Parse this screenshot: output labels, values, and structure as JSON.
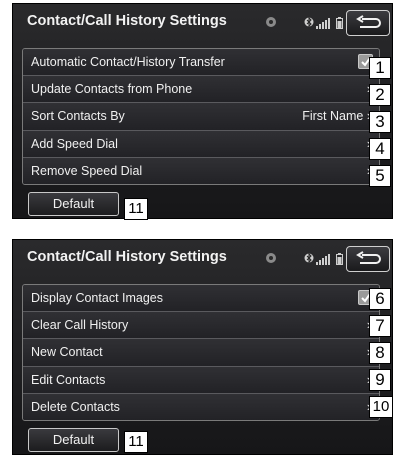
{
  "screens": [
    {
      "title": "Contact/Call History Settings",
      "back_label": "back",
      "rows": [
        {
          "label": "Automatic Contact/History Transfer",
          "value": "",
          "control": "checkbox",
          "checked": true,
          "callout": "1"
        },
        {
          "label": "Update Contacts from Phone",
          "value": "",
          "control": "chevron",
          "chevron": "›",
          "callout": "2"
        },
        {
          "label": "Sort Contacts By",
          "value": "First Name",
          "control": "chevron",
          "chevron": "›",
          "callout": "3"
        },
        {
          "label": "Add Speed Dial",
          "value": "",
          "control": "chevron",
          "chevron": "›",
          "callout": "4"
        },
        {
          "label": "Remove Speed Dial",
          "value": "",
          "control": "chevron",
          "chevron": "›",
          "callout": "5"
        }
      ],
      "default_label": "Default",
      "default_callout": "11"
    },
    {
      "title": "Contact/Call History Settings",
      "back_label": "back",
      "rows": [
        {
          "label": "Display Contact Images",
          "value": "",
          "control": "checkbox",
          "checked": true,
          "callout": "6"
        },
        {
          "label": "Clear Call History",
          "value": "",
          "control": "chevron",
          "chevron": "›",
          "callout": "7"
        },
        {
          "label": "New Contact",
          "value": "",
          "control": "chevron",
          "chevron": "›",
          "callout": "8"
        },
        {
          "label": "Edit Contacts",
          "value": "",
          "control": "chevron",
          "chevron": "›",
          "callout": "9"
        },
        {
          "label": "Delete Contacts",
          "value": "",
          "control": "chevron",
          "chevron": "›",
          "callout": "10"
        }
      ],
      "default_label": "Default",
      "default_callout": "11"
    }
  ],
  "icons": {
    "title_icon": "gear-icon",
    "bluetooth": "bluetooth-icon",
    "signal": "signal-bars-icon",
    "battery": "battery-icon",
    "back": "back-arrow-icon"
  },
  "colors": {
    "screen_bg": "#1e1e20",
    "row_bg": "#2a2a2e",
    "text": "#f0f0f0",
    "border": "#7a7a7a",
    "callout_bg": "#ffffff"
  }
}
